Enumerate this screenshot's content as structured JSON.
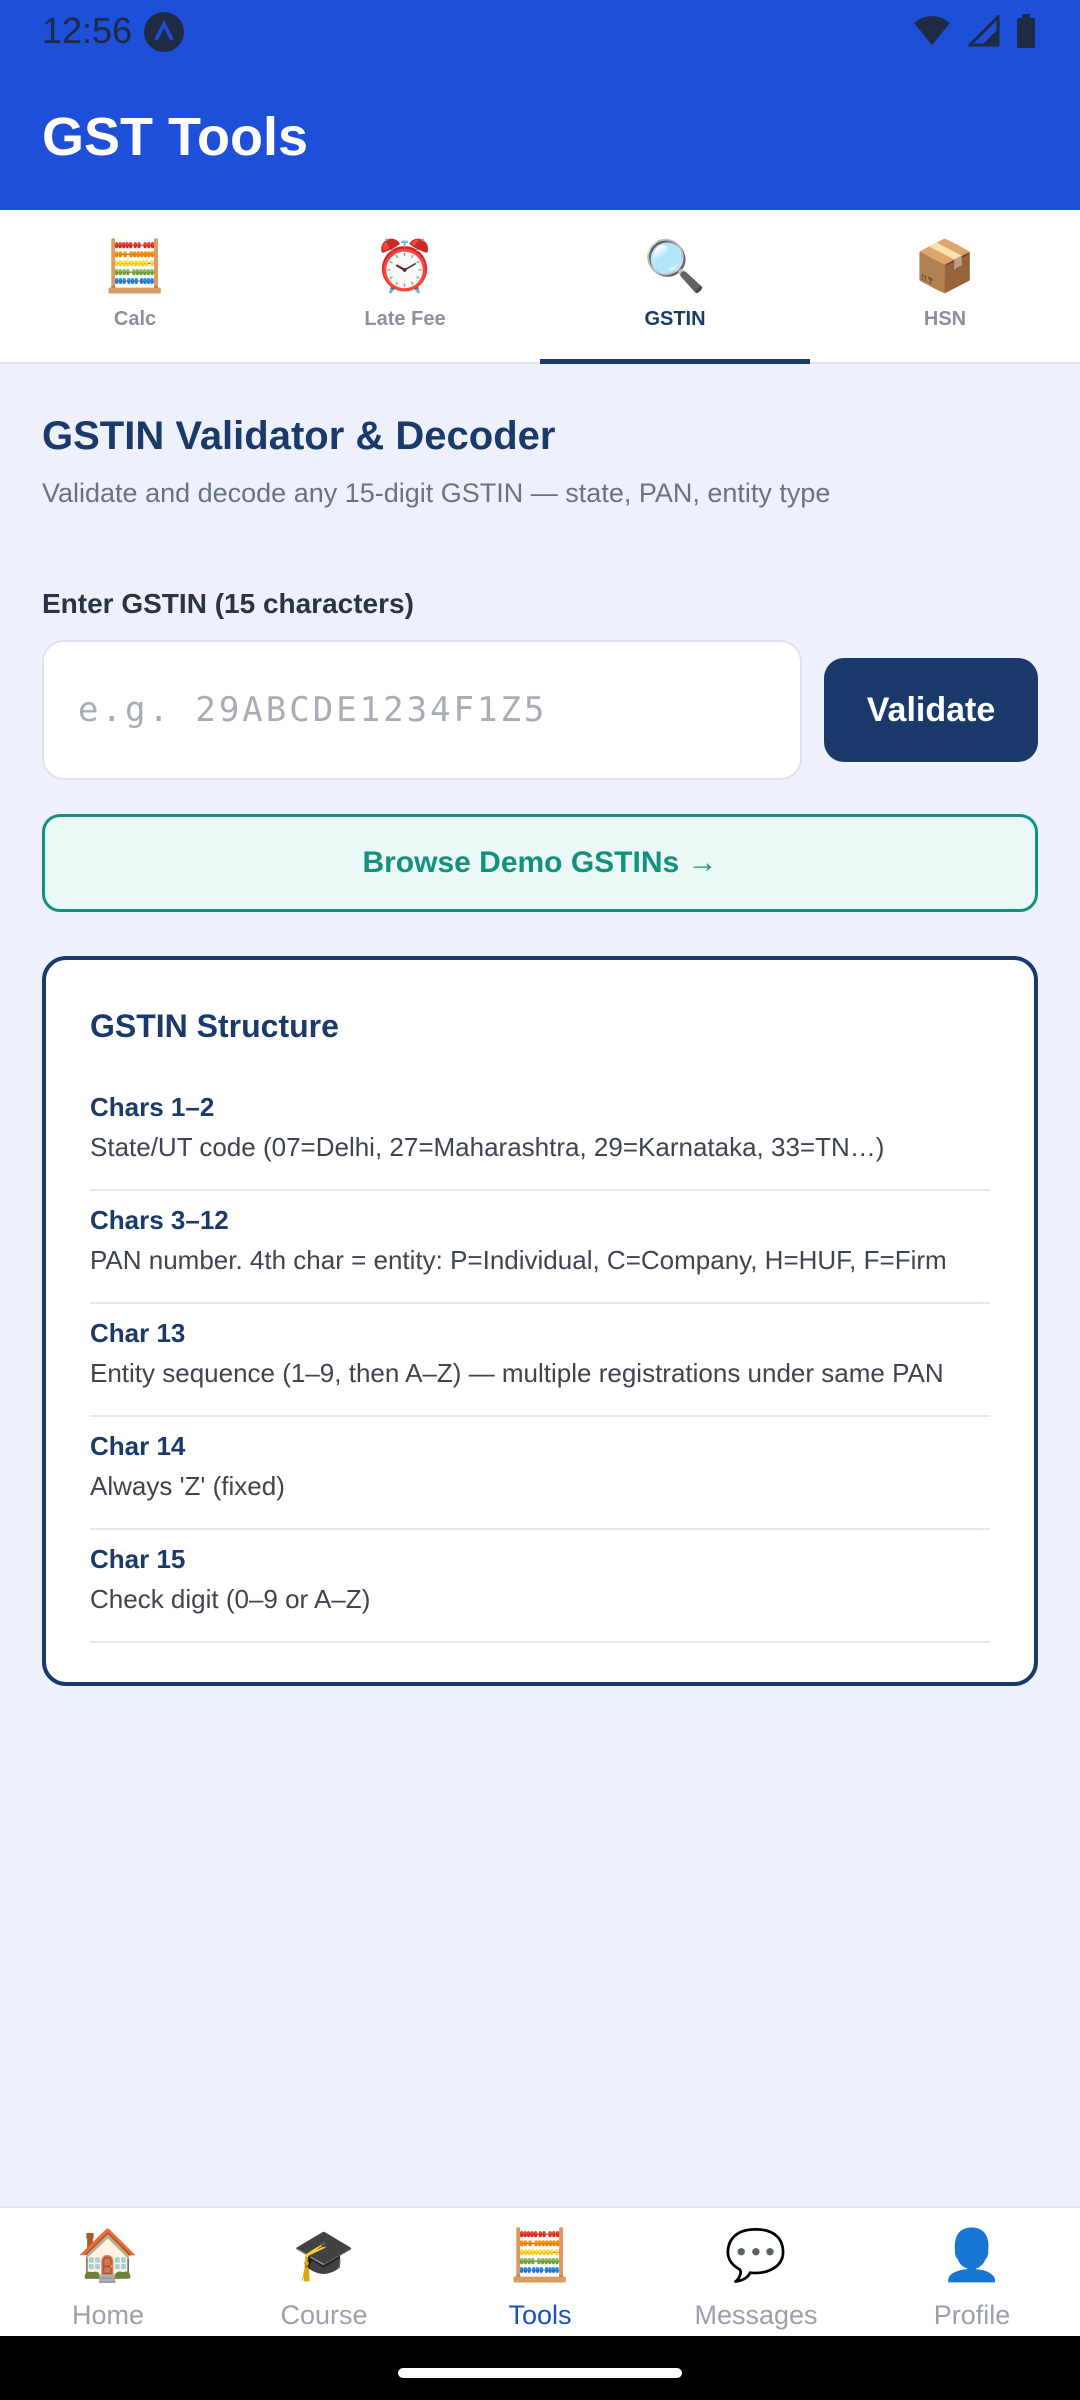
{
  "status_bar": {
    "time": "12:56"
  },
  "app_bar": {
    "title": "GST Tools"
  },
  "tabs": [
    {
      "emoji": "🧮",
      "label": "Calc",
      "active": false
    },
    {
      "emoji": "⏰",
      "label": "Late Fee",
      "active": false
    },
    {
      "emoji": "🔍",
      "label": "GSTIN",
      "active": true
    },
    {
      "emoji": "📦",
      "label": "HSN",
      "active": false
    }
  ],
  "main": {
    "title": "GSTIN Validator & Decoder",
    "subtitle": "Validate and decode any 15-digit GSTIN — state, PAN, entity type",
    "input_label": "Enter GSTIN (15 characters)",
    "input_value": "",
    "input_placeholder": "e.g. 29ABCDE1234F1Z5",
    "validate_label": "Validate",
    "browse_label": "Browse Demo GSTINs →"
  },
  "structure": {
    "title": "GSTIN Structure",
    "rows": [
      {
        "head": "Chars 1–2",
        "desc": "State/UT code (07=Delhi, 27=Maharashtra, 29=Karnataka, 33=TN…)"
      },
      {
        "head": "Chars 3–12",
        "desc": "PAN number. 4th char = entity: P=Individual, C=Company, H=HUF, F=Firm"
      },
      {
        "head": "Char 13",
        "desc": "Entity sequence (1–9, then A–Z) — multiple registrations under same PAN"
      },
      {
        "head": "Char 14",
        "desc": "Always 'Z' (fixed)"
      },
      {
        "head": "Char 15",
        "desc": "Check digit (0–9 or A–Z)"
      }
    ]
  },
  "bottom_nav": [
    {
      "emoji": "🏠",
      "label": "Home",
      "active": false
    },
    {
      "emoji": "🎓",
      "label": "Course",
      "active": false
    },
    {
      "emoji": "🧮",
      "label": "Tools",
      "active": true
    },
    {
      "emoji": "💬",
      "label": "Messages",
      "active": false
    },
    {
      "emoji": "👤",
      "label": "Profile",
      "active": false
    }
  ],
  "colors": {
    "primary": "#1e4fd8",
    "navy": "#1a3a6b",
    "teal": "#13907f",
    "background": "#eef1fb"
  }
}
